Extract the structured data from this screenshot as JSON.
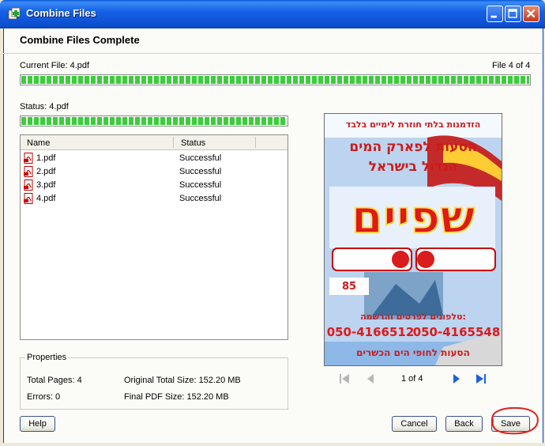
{
  "window": {
    "title": "Combine Files",
    "heading": "Combine Files Complete"
  },
  "current_file": {
    "label": "Current File: 4.pdf",
    "counter": "File 4 of 4",
    "progress": 1.0
  },
  "status": {
    "label": "Status: 4.pdf",
    "progress": 1.0
  },
  "file_list": {
    "columns": [
      "Name",
      "Status"
    ],
    "rows": [
      {
        "name": "1.pdf",
        "status": "Successful"
      },
      {
        "name": "2.pdf",
        "status": "Successful"
      },
      {
        "name": "3.pdf",
        "status": "Successful"
      },
      {
        "name": "4.pdf",
        "status": "Successful"
      }
    ]
  },
  "properties": {
    "title": "Properties",
    "total_pages": "Total Pages: 4",
    "errors": "Errors: 0",
    "original_size": "Original Total Size: 152.20 MB",
    "final_size": "Final PDF Size: 152.20 MB"
  },
  "preview": {
    "page_info": "1 of 4",
    "poster": {
      "line1": "הזדמנות בלתי חוזרת לימיים בלבד",
      "line2": "הסעות לפארק המים",
      "line3": "הגדול בישראל",
      "big": "שפיים",
      "phone_label": "טלפונים לפרטים והרשמה:",
      "phone1": "050-4166512",
      "phone2": "050-4165548",
      "footer": "הסעות לחופי הים הכשרים",
      "price": "85"
    }
  },
  "buttons": {
    "help": "Help",
    "cancel": "Cancel",
    "back": "Back",
    "save": "Save"
  },
  "colors": {
    "titlebar": "#0c4fd0",
    "progress": "#3ccc3c",
    "annotation": "#e0201c",
    "nav_active": "#1e63d6"
  }
}
